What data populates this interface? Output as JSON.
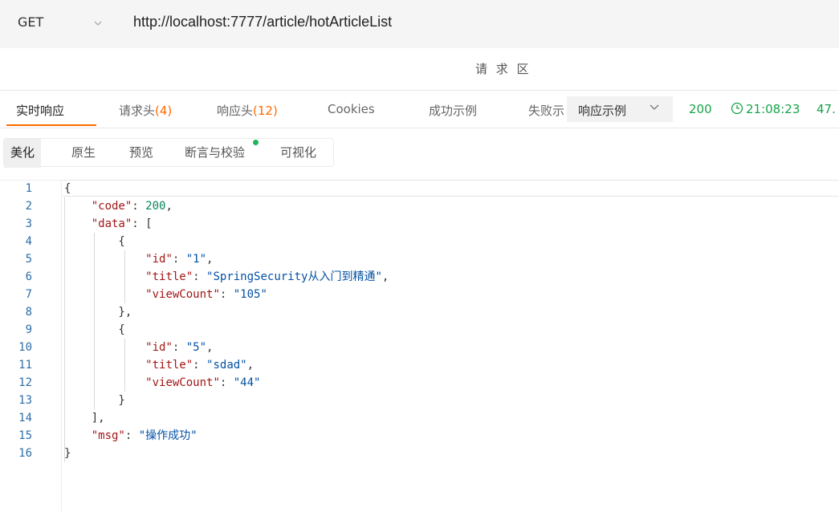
{
  "request": {
    "method": "GET",
    "url": "http://localhost:7777/article/hotArticleList",
    "section_label": "请 求 区"
  },
  "tabs": [
    {
      "label": "实时响应",
      "count": ""
    },
    {
      "label": "请求头",
      "count": "(4)"
    },
    {
      "label": "响应头",
      "count": "(12)"
    },
    {
      "label": "Cookies",
      "count": ""
    },
    {
      "label": "成功示例",
      "count": ""
    },
    {
      "label": "失败示",
      "count": ""
    }
  ],
  "example_button": {
    "label": "响应示例"
  },
  "status": {
    "code": "200",
    "time": "21:08:23",
    "size": "47."
  },
  "subtabs": [
    "美化",
    "原生",
    "预览",
    "断言与校验",
    "可视化"
  ],
  "code_lines": [
    {
      "n": "1",
      "text": "{"
    },
    {
      "n": "2",
      "text": "    \"code\": 200,"
    },
    {
      "n": "3",
      "text": "    \"data\": ["
    },
    {
      "n": "4",
      "text": "        {"
    },
    {
      "n": "5",
      "text": "            \"id\": \"1\","
    },
    {
      "n": "6",
      "text": "            \"title\": \"SpringSecurity从入门到精通\","
    },
    {
      "n": "7",
      "text": "            \"viewCount\": \"105\""
    },
    {
      "n": "8",
      "text": "        },"
    },
    {
      "n": "9",
      "text": "        {"
    },
    {
      "n": "10",
      "text": "            \"id\": \"5\","
    },
    {
      "n": "11",
      "text": "            \"title\": \"sdad\","
    },
    {
      "n": "12",
      "text": "            \"viewCount\": \"44\""
    },
    {
      "n": "13",
      "text": "        }"
    },
    {
      "n": "14",
      "text": "    ],"
    },
    {
      "n": "15",
      "text": "    \"msg\": \"操作成功\""
    },
    {
      "n": "16",
      "text": "}"
    }
  ],
  "colors": {
    "accent": "#ff6a00",
    "status_green": "#17a34a",
    "json_key": "#a31515",
    "json_string": "#0451a5",
    "json_number": "#098658"
  }
}
